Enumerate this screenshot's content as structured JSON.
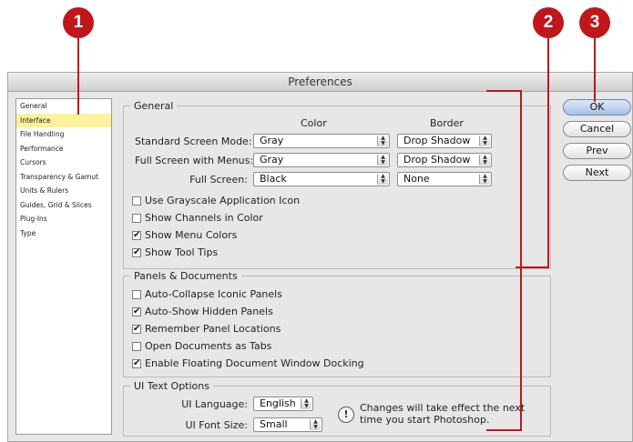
{
  "window": {
    "title": "Preferences"
  },
  "callouts": [
    "1",
    "2",
    "3"
  ],
  "sidebar": {
    "items": [
      "General",
      "Interface",
      "File Handling",
      "Performance",
      "Cursors",
      "Transparency & Gamut",
      "Units & Rulers",
      "Guides, Grid & Slices",
      "Plug-Ins",
      "Type"
    ],
    "selected": "Interface"
  },
  "general": {
    "legend": "General",
    "color_header": "Color",
    "border_header": "Border",
    "rows": [
      {
        "label": "Standard Screen Mode:",
        "color": "Gray",
        "border": "Drop Shadow"
      },
      {
        "label": "Full Screen with Menus:",
        "color": "Gray",
        "border": "Drop Shadow"
      },
      {
        "label": "Full Screen:",
        "color": "Black",
        "border": "None"
      }
    ],
    "checks": [
      {
        "label": "Use Grayscale Application Icon",
        "checked": false
      },
      {
        "label": "Show Channels in Color",
        "checked": false
      },
      {
        "label": "Show Menu Colors",
        "checked": true
      },
      {
        "label": "Show Tool Tips",
        "checked": true
      }
    ]
  },
  "panels": {
    "legend": "Panels & Documents",
    "checks": [
      {
        "label": "Auto-Collapse Iconic Panels",
        "checked": false
      },
      {
        "label": "Auto-Show Hidden Panels",
        "checked": true
      },
      {
        "label": "Remember Panel Locations",
        "checked": true
      },
      {
        "label": "Open Documents as Tabs",
        "checked": false
      },
      {
        "label": "Enable Floating Document Window Docking",
        "checked": true
      }
    ]
  },
  "ui_text": {
    "legend": "UI Text Options",
    "language_label": "UI Language:",
    "language_value": "English",
    "font_size_label": "UI Font Size:",
    "font_size_value": "Small",
    "note_line1": "Changes will take effect the next",
    "note_line2": "time you start Photoshop.",
    "note_icon": "exclamation-icon"
  },
  "buttons": {
    "ok": "OK",
    "cancel": "Cancel",
    "prev": "Prev",
    "next": "Next"
  },
  "colors": {
    "callout": "#c0161c",
    "selection": "#fbf29a",
    "default_button": "#a8c1e6"
  }
}
